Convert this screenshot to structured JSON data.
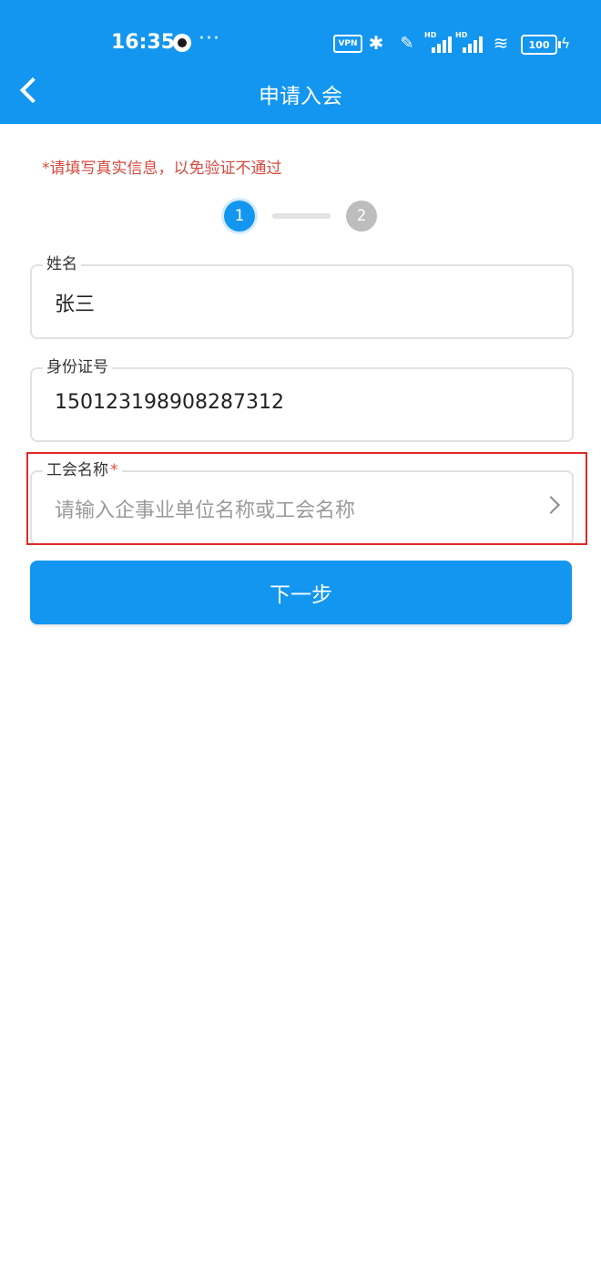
{
  "status_bar": {
    "time": "16:35",
    "more": "···",
    "vpn": "VPN",
    "bluetooth_glyph": "✱",
    "mute_glyph": "✎",
    "hd1": "HD",
    "hd2": "HD",
    "wifi_glyph": "≋",
    "battery": "100",
    "charge_glyph": "ϟ"
  },
  "header": {
    "title": "申请入会"
  },
  "notice": "*请填写真实信息，以免验证不通过",
  "steps": [
    "1",
    "2"
  ],
  "form": {
    "name": {
      "label": "姓名",
      "value": "张三"
    },
    "id_number": {
      "label": "身份证号",
      "value": "150123198908287312"
    },
    "union": {
      "label": "工会名称",
      "required_mark": "*",
      "placeholder": "请输入企事业单位名称或工会名称"
    }
  },
  "next_button": "下一步",
  "colors": {
    "primary": "#1296f0",
    "warning": "#d84a3f",
    "highlight": "#e02a2a",
    "step_inactive": "#bdbdbd"
  }
}
